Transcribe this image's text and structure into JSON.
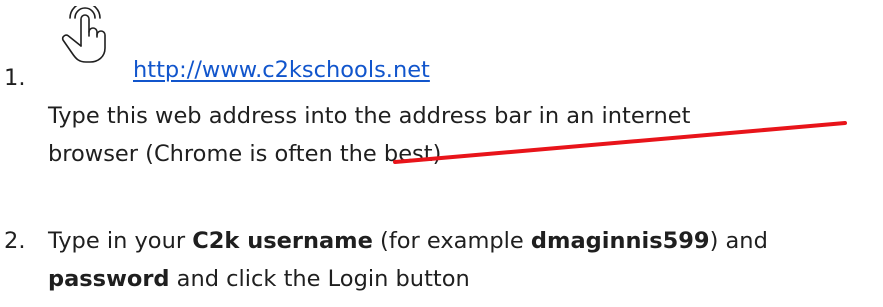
{
  "steps": [
    {
      "number": "1.",
      "icon": "tap-gesture-icon",
      "link_text": "http://www.c2kschools.net",
      "line1": "Type this web address into the address bar in an internet",
      "line2": "browser (Chrome is often the best)",
      "underline_color": "#e8141a"
    },
    {
      "number": "2.",
      "text_a": "Type in your ",
      "bold_a": "C2k username",
      "text_b": " (for example ",
      "bold_b": "dmaginnis599",
      "text_c": ") and",
      "bold_c": "password",
      "text_d": " and click the Login button"
    }
  ]
}
